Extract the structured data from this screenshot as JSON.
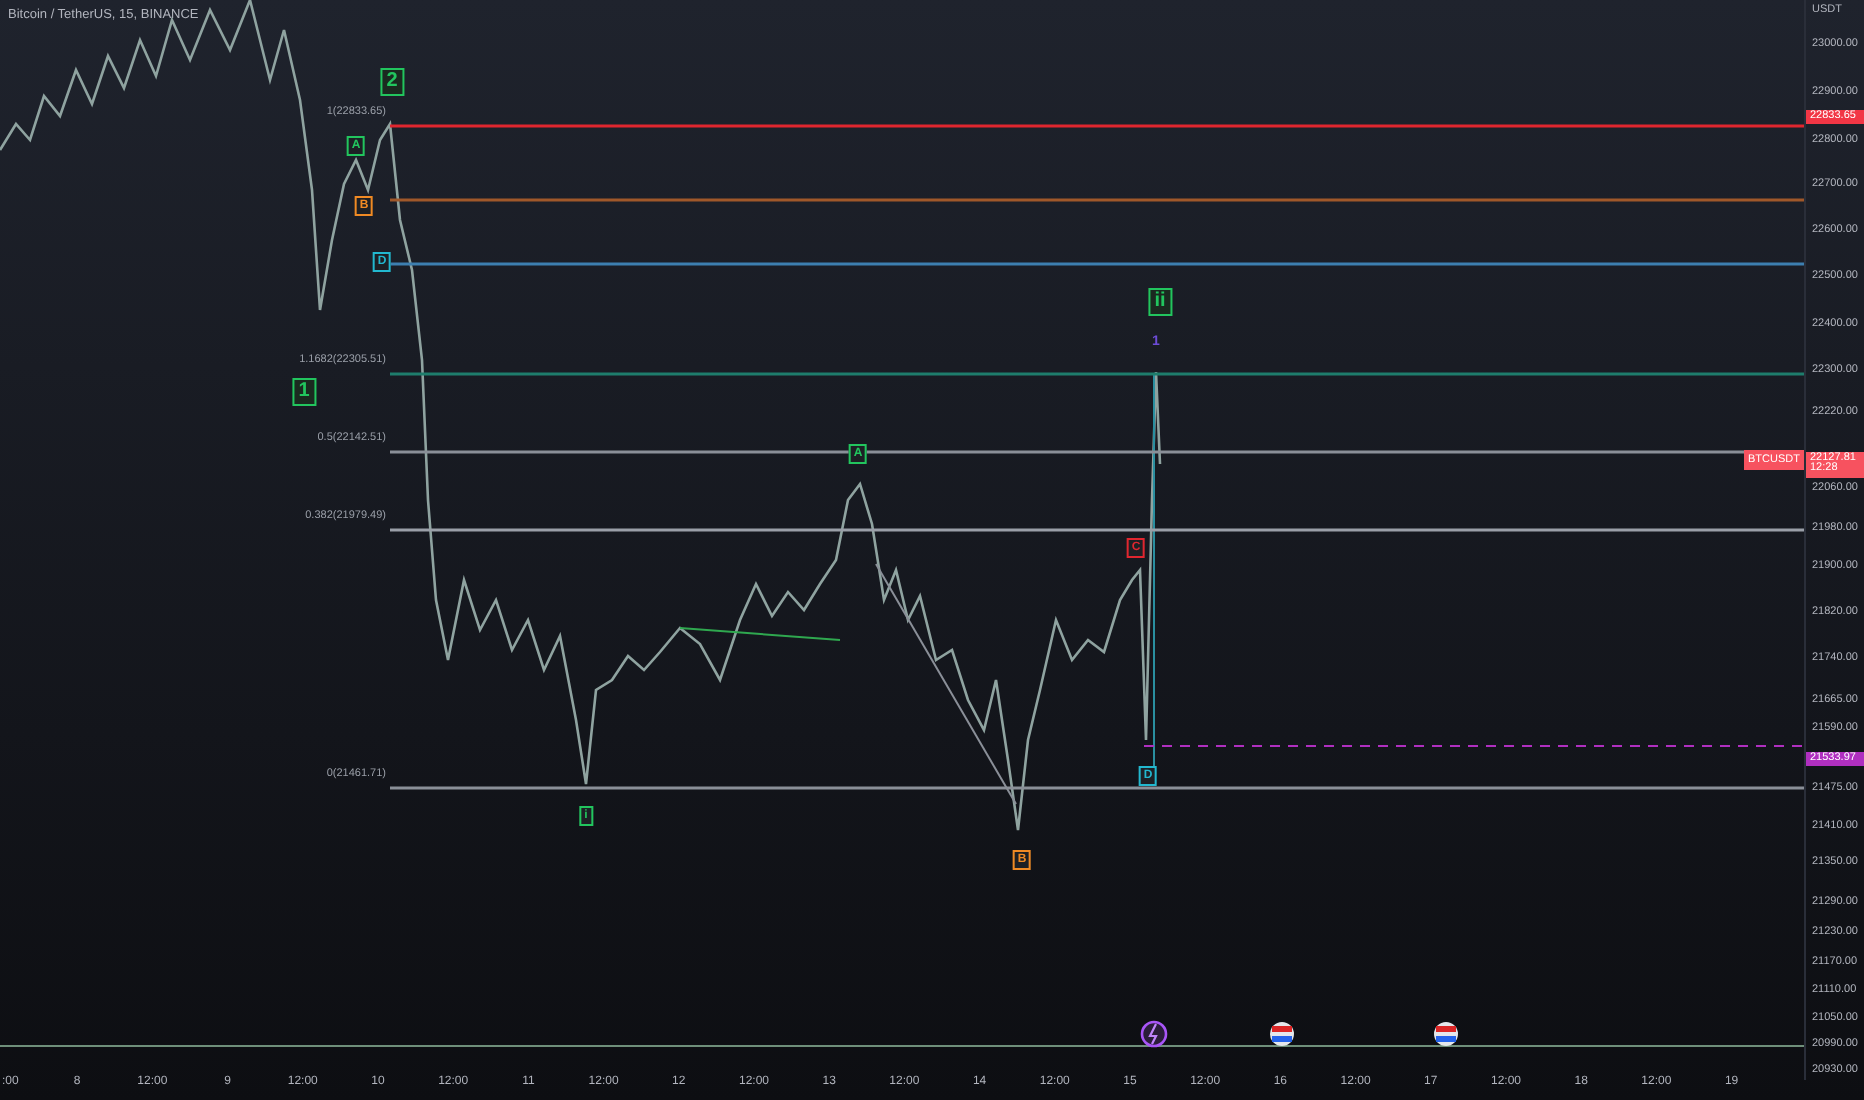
{
  "title": "Bitcoin / TetherUS, 15, BINANCE",
  "price_axis": {
    "currency": "USDT",
    "ticks": [
      "23000.00",
      "22900.00",
      "22800.00",
      "22700.00",
      "22600.00",
      "22500.00",
      "22400.00",
      "22300.00",
      "22220.00",
      "22060.00",
      "21980.00",
      "21900.00",
      "21820.00",
      "21740.00",
      "21665.00",
      "21590.00",
      "21475.00",
      "21410.00",
      "21350.00",
      "21290.00",
      "21230.00",
      "21170.00",
      "21110.00",
      "21050.00",
      "20990.00",
      "20930.00"
    ]
  },
  "price_badges": [
    {
      "label": "22833.65",
      "color": "#f23645"
    },
    {
      "symbol": "BTCUSDT",
      "label": "22127.81",
      "countdown": "12:28",
      "color": "#f7525f"
    },
    {
      "label": "21533.97",
      "color": "#b02fc0"
    }
  ],
  "fib_levels": [
    {
      "label": "1(22833.65)",
      "color": "#e0262f"
    },
    {
      "color": "#a0582a"
    },
    {
      "color": "#3d7fb0"
    },
    {
      "label": "1.1682(22305.51)",
      "color": "#1e7d6c"
    },
    {
      "label": "0.5(22142.51)",
      "color": "#8a8f98"
    },
    {
      "label": "0.382(21979.49)",
      "color": "#9a9fa8"
    },
    {
      "label": "0(21461.71)",
      "color": "#8a8f98"
    }
  ],
  "wave_labels": [
    {
      "text": "2",
      "kind": "major",
      "color": "#22c55e"
    },
    {
      "text": "1",
      "kind": "major",
      "color": "#22c55e"
    },
    {
      "text": "A",
      "kind": "minor",
      "color": "#22c55e"
    },
    {
      "text": "B",
      "kind": "minor",
      "color": "#f08a24"
    },
    {
      "text": "D",
      "kind": "minor",
      "color": "#22b8cf"
    },
    {
      "text": "A",
      "kind": "minor",
      "color": "#22c55e"
    },
    {
      "text": "i",
      "kind": "minor",
      "color": "#22c55e"
    },
    {
      "text": "B",
      "kind": "minor",
      "color": "#f08a24"
    },
    {
      "text": "C",
      "kind": "minor",
      "color": "#e0262f"
    },
    {
      "text": "D",
      "kind": "minor",
      "color": "#22b8cf"
    },
    {
      "text": "ii",
      "kind": "major",
      "color": "#22c55e"
    },
    {
      "text": "1",
      "kind": "plain",
      "color": "#6d4cd8"
    }
  ],
  "time_axis": [
    ":00",
    "8",
    "12:00",
    "9",
    "12:00",
    "10",
    "12:00",
    "11",
    "12:00",
    "12",
    "12:00",
    "13",
    "12:00",
    "14",
    "12:00",
    "15",
    "12:00",
    "16",
    "12:00",
    "17",
    "12:00",
    "18",
    "12:00",
    "19"
  ]
}
